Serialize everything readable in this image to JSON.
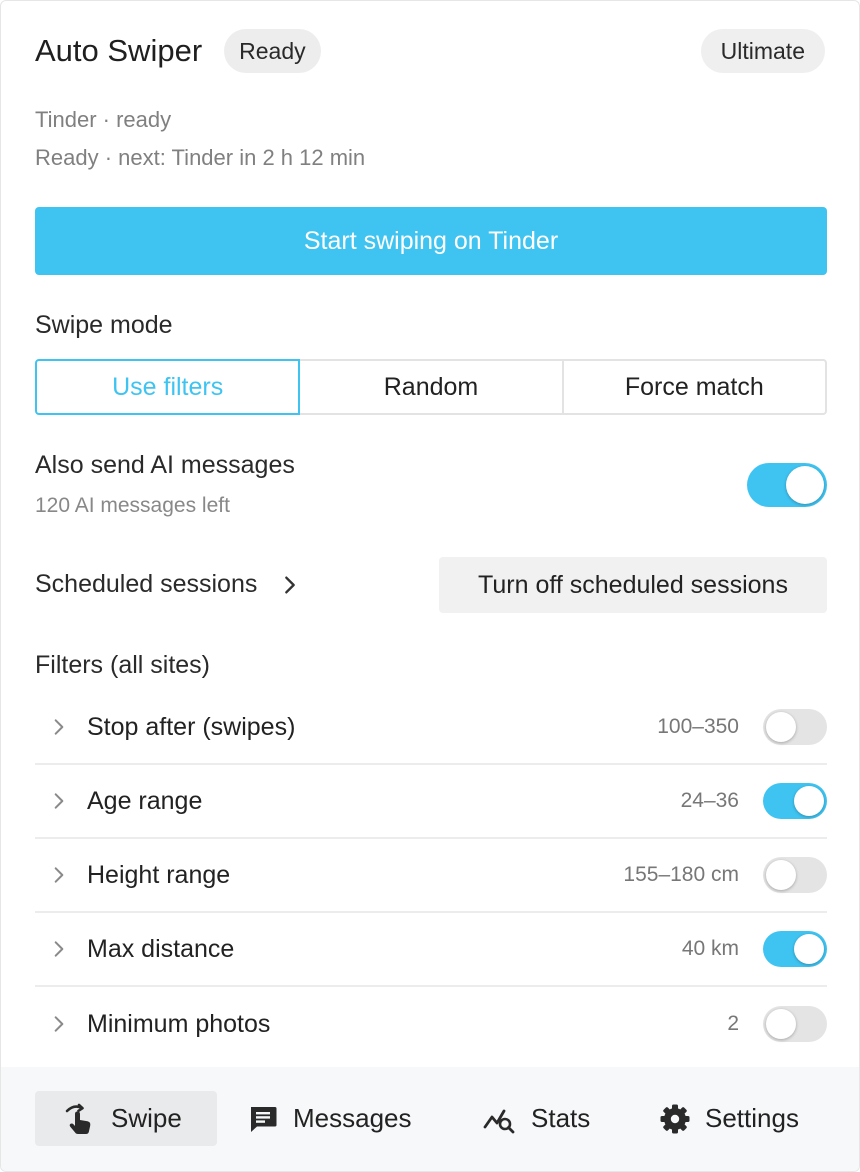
{
  "header": {
    "title": "Auto Swiper",
    "status_badge": "Ready",
    "plan_badge": "Ultimate"
  },
  "status": {
    "line1": "Tinder · ready",
    "line2": "Ready · next: Tinder in 2 h 12 min"
  },
  "primary_button": "Start swiping on Tinder",
  "swipe_mode": {
    "label": "Swipe mode",
    "options": [
      "Use filters",
      "Random",
      "Force match"
    ],
    "selected": "Use filters"
  },
  "ai_messages": {
    "label": "Also send AI messages",
    "remaining": "120 AI messages left",
    "enabled": true
  },
  "scheduled": {
    "label": "Scheduled sessions",
    "button": "Turn off scheduled sessions"
  },
  "filters": {
    "label": "Filters (all sites)",
    "items": [
      {
        "name": "Stop after (swipes)",
        "value": "100–350",
        "enabled": false
      },
      {
        "name": "Age range",
        "value": "24–36",
        "enabled": true
      },
      {
        "name": "Height range",
        "value": "155–180 cm",
        "enabled": false
      },
      {
        "name": "Max distance",
        "value": "40 km",
        "enabled": true
      },
      {
        "name": "Minimum photos",
        "value": "2",
        "enabled": false
      }
    ]
  },
  "tabs": {
    "items": [
      {
        "label": "Swipe",
        "icon": "swipe-hand-icon"
      },
      {
        "label": "Messages",
        "icon": "message-icon"
      },
      {
        "label": "Stats",
        "icon": "stats-icon"
      },
      {
        "label": "Settings",
        "icon": "gear-icon"
      }
    ],
    "active": "Swipe"
  },
  "colors": {
    "accent": "#3fc4f2",
    "toggle_off": "#e4e4e4",
    "muted_text": "#808080"
  }
}
